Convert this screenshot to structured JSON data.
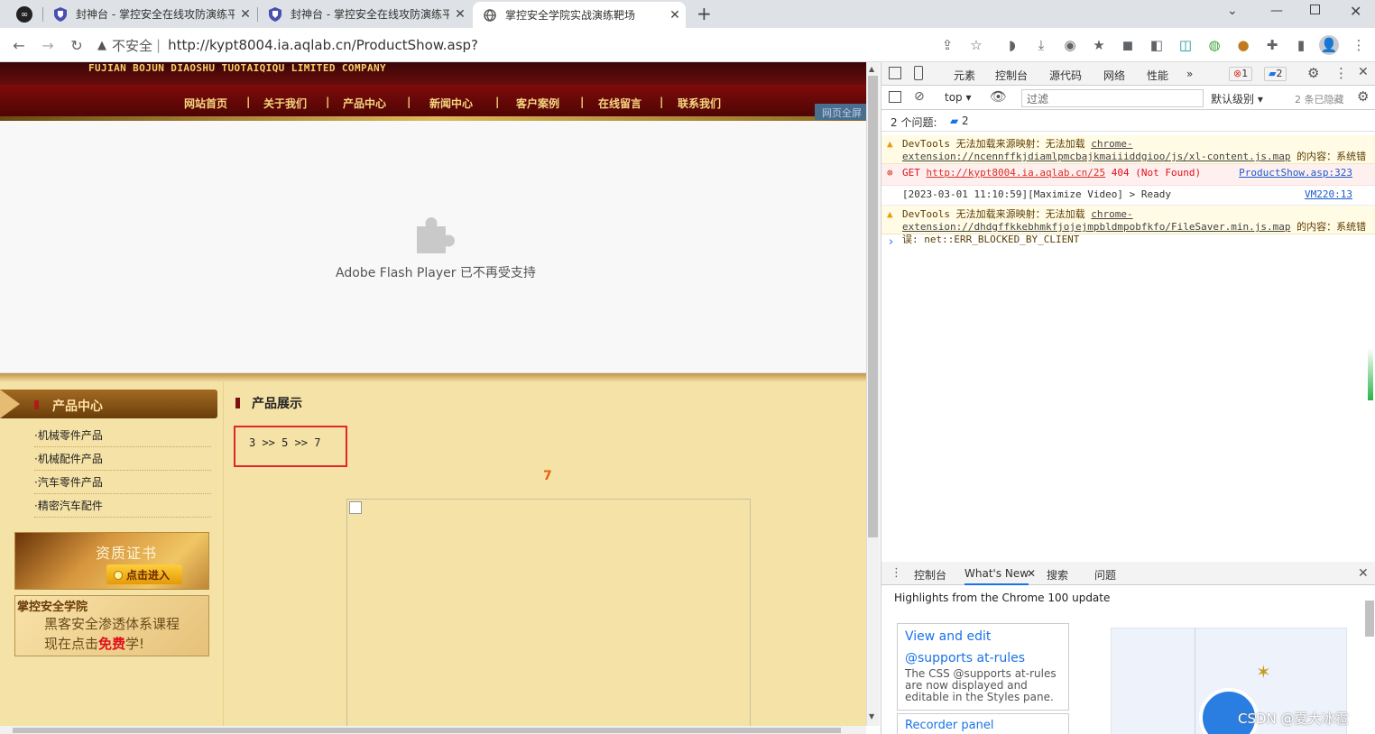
{
  "tabs": [
    {
      "title": "封神台 - 掌控安全在线攻防演练平台",
      "icon": "shield-icon"
    },
    {
      "title": "封神台 - 掌控安全在线攻防演练平台",
      "icon": "shield-icon"
    },
    {
      "title": "掌控安全学院实战演练靶场",
      "icon": "globe-icon"
    }
  ],
  "address": {
    "security": "不安全",
    "separator": "|",
    "url": "http://kypt8004.ia.aqlab.cn/ProductShow.asp?"
  },
  "site": {
    "company": "FUJIAN BOJUN DIAOSHU TUOTAIQIQU LIMITED COMPANY",
    "nav": [
      "网站首页",
      "关于我们",
      "产品中心",
      "新闻中心",
      "客户案例",
      "在线留言",
      "联系我们"
    ],
    "corner_label": "网页全屏",
    "flash_message": "Adobe Flash Player 已不再受支持",
    "sidebar_title": "产品中心",
    "sidebar_items": [
      "·机械零件产品",
      "·机械配件产品",
      "·汽车零件产品",
      "·精密汽车配件"
    ],
    "cert_title": "资质证书",
    "cert_button": "点击进入",
    "academy_title": "掌控安全学院",
    "academy_line1": "黑客安全渗透体系课程",
    "academy_line2_a": "现在点击",
    "academy_line2_free": "免费",
    "academy_line2_b": "学!",
    "main_title": "产品展示",
    "highlight_text": "3 >> 5 >> 7",
    "result_number": "7"
  },
  "devtools": {
    "tabs": [
      "元素",
      "控制台",
      "源代码",
      "网络",
      "性能"
    ],
    "more": "»",
    "error_count": "1",
    "msg_count": "2",
    "context": "top",
    "filter_placeholder": "过滤",
    "level": "默认级别",
    "hidden": "2 条已隐藏",
    "issues_label": "2 个问题:",
    "issues_count": "2",
    "console": [
      {
        "type": "warn",
        "text": "DevTools 无法加载来源映射：无法加载 ",
        "link": "chrome-extension://ncennffkjdiamlpmcbajkmaiiiddgioo/js/xl-content.js.map",
        "tail": " 的内容：系统错误: net::ERR_BLOCKED_BY_CLIENT"
      },
      {
        "type": "err",
        "text": "GET ",
        "link": "http://kypt8004.ia.aqlab.cn/25",
        "tail": " 404 (Not Found)",
        "src": "ProductShow.asp:323"
      },
      {
        "type": "info",
        "text": "[2023-03-01 11:10:59][Maximize Video] > Ready",
        "src": "VM220:13"
      },
      {
        "type": "warn",
        "text": "DevTools 无法加载来源映射：无法加载 ",
        "link": "chrome-extension://dhdgffkkebhmkfjojejmpbldmpobfkfo/FileSaver.min.js.map",
        "tail": " 的内容：系统错误: net::ERR_BLOCKED_BY_CLIENT"
      }
    ],
    "prompt": "›",
    "drawer_tabs": [
      "控制台",
      "What's New",
      "搜索",
      "问题"
    ],
    "highlights": "Highlights from the Chrome 100 update",
    "card1_title": "View and edit @supports at-rules",
    "card1_desc": "The CSS @supports at-rules are now displayed and editable in the Styles pane.",
    "card2_title": "Recorder panel"
  },
  "watermark": "CSDN @夏大冰雹"
}
